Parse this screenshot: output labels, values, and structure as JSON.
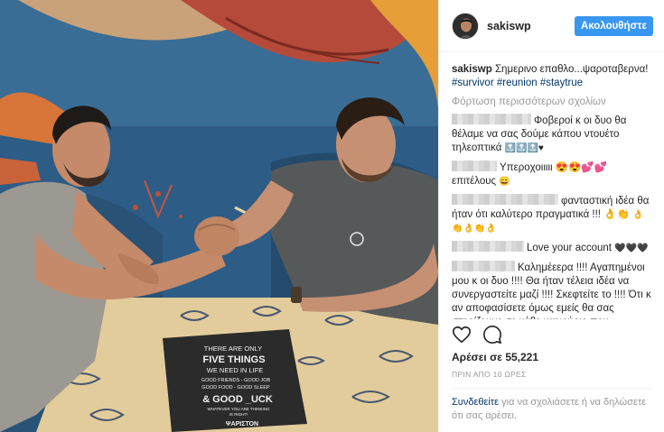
{
  "post": {
    "username": "sakiswp",
    "follow_label": "Ακολουθήστε",
    "caption_text": " Σημερινο επαθλο...ψαροταβερνα!",
    "hashtags": [
      "#survivor",
      "#reunion",
      "#staytrue"
    ],
    "load_more": "Φόρτωση περισσότερων σχολίων",
    "likes": "Αρέσει σε 55,221",
    "timestamp": "ΠΡΙΝ ΑΠΟ 10 ΩΡΕΣ",
    "login_link": "Συνδεθείτε",
    "login_text": " για να σχολιάσετε ή να δηλώσετε ότι σας αρέσει."
  },
  "comments": [
    {
      "text": "Φοβεροί κ οι δυο θα θέλαμε να σας δούμε κάπου ντουέτο τηλεοπτικά",
      "emoji": "🔝🔝🔝♥"
    },
    {
      "text": "Υπερoχοιιιιι 😍😍💕💕 επιτέλους",
      "emoji": "😄"
    },
    {
      "text": "φανταστική ιδέα θα ήταν ότι καλύτερο πραγματικά !!! 👌👏",
      "emoji": "👌👏👌👏👌"
    },
    {
      "text": "Love your account",
      "emoji": "🖤🖤🖤"
    },
    {
      "text": "Καλημέεερα !!!! Αγαπημένοι μου κ οι δυο !!!! Θα ήταν τέλεια ιδέα να συνεργαστείτε μαζί !!!! Σκεφτείτε το !!!! Ότι κ αν αποφασίσετε όμως εμείς θα σας στηρίζουμε σε κάθε καινούριο που",
      "emoji": ""
    }
  ],
  "photo_sign": {
    "line1": "THERE ARE ONLY",
    "line2": "FIVE THINGS",
    "line3": "WE NEED IN LIFE",
    "line4": "GOOD FRIENDS - GOOD JOB",
    "line5": "GOOD FOOD - GOOD SLEEP",
    "line6": "& GOOD _UCK",
    "line7": "WHATEVER YOU ARE THINKING",
    "line8": "IS RIGHT!",
    "brand": "ΨΑΡΙΣΤΟΝ"
  },
  "icons": {
    "like": "heart-icon",
    "comment": "comment-bubble-icon"
  },
  "colors": {
    "accent": "#3897f0",
    "link": "#003569",
    "muted": "#999999"
  }
}
